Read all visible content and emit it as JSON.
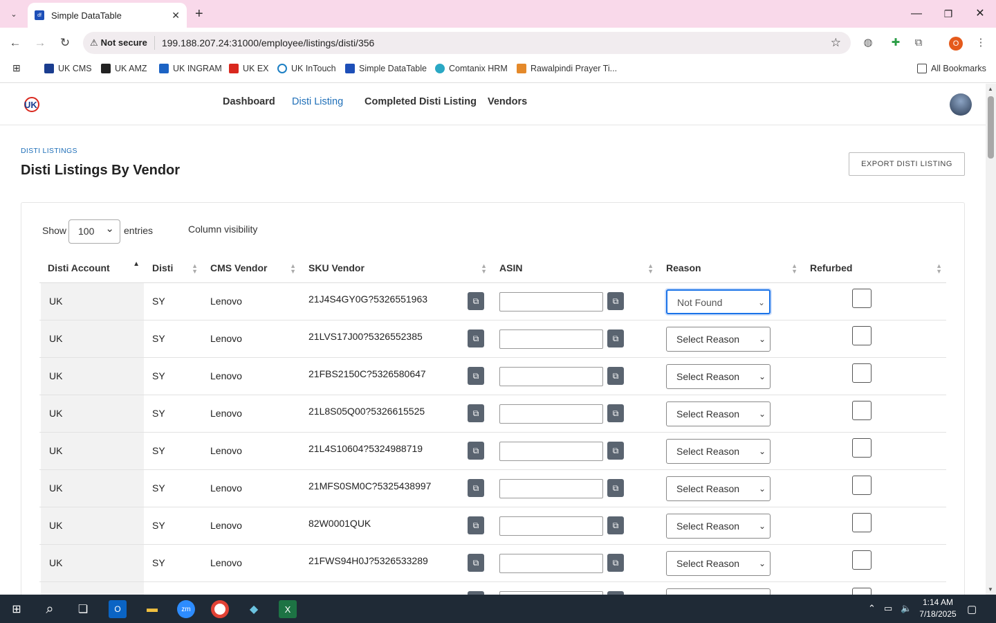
{
  "browser": {
    "tab_title": "Simple DataTable",
    "tab_favicon": "df",
    "not_secure": "Not secure",
    "url": "199.188.207.24:31000/employee/listings/disti/356",
    "profile_initial": "O",
    "bookmarks": [
      "UK CMS",
      "UK AMZ",
      "UK INGRAM",
      "UK EX",
      "UK InTouch",
      "Simple DataTable",
      "Comtanix HRM",
      "Rawalpindi Prayer Ti..."
    ],
    "all_bookmarks": "All Bookmarks"
  },
  "nav": {
    "links": [
      "Dashboard",
      "Disti Listing",
      "Completed Disti Listing",
      "Vendors"
    ],
    "active": "Disti Listing"
  },
  "page": {
    "breadcrumb": "DISTI LISTINGS",
    "title": "Disti Listings By Vendor",
    "export_label": "EXPORT DISTI LISTING"
  },
  "table_controls": {
    "show": "Show",
    "entries_value": "100",
    "entries": "entries",
    "column_visibility": "Column visibility"
  },
  "table": {
    "headers": [
      "Disti Account",
      "Disti",
      "CMS Vendor",
      "SKU Vendor",
      "ASIN",
      "Reason",
      "Refurbed"
    ],
    "rows": [
      {
        "account": "UK",
        "disti": "SY",
        "vendor": "Lenovo",
        "sku": "21J4S4GY0G?5326551963",
        "reason": "Not Found"
      },
      {
        "account": "UK",
        "disti": "SY",
        "vendor": "Lenovo",
        "sku": "21LVS17J00?5326552385",
        "reason": "Select Reason"
      },
      {
        "account": "UK",
        "disti": "SY",
        "vendor": "Lenovo",
        "sku": "21FBS2150C?5326580647",
        "reason": "Select Reason"
      },
      {
        "account": "UK",
        "disti": "SY",
        "vendor": "Lenovo",
        "sku": "21L8S05Q00?5326615525",
        "reason": "Select Reason"
      },
      {
        "account": "UK",
        "disti": "SY",
        "vendor": "Lenovo",
        "sku": "21L4S10604?5324988719",
        "reason": "Select Reason"
      },
      {
        "account": "UK",
        "disti": "SY",
        "vendor": "Lenovo",
        "sku": "21MFS0SM0C?5325438997",
        "reason": "Select Reason"
      },
      {
        "account": "UK",
        "disti": "SY",
        "vendor": "Lenovo",
        "sku": "82W0001QUK",
        "reason": "Select Reason"
      },
      {
        "account": "UK",
        "disti": "SY",
        "vendor": "Lenovo",
        "sku": "21FWS94H0J?5326533289",
        "reason": "Select Reason"
      }
    ]
  },
  "taskbar": {
    "time": "1:14 AM",
    "date": "7/18/2025"
  },
  "colors": {
    "tab_strip": "#f9d9ea",
    "accent_link": "#1f6fb8",
    "taskbar": "#1f2a36"
  }
}
